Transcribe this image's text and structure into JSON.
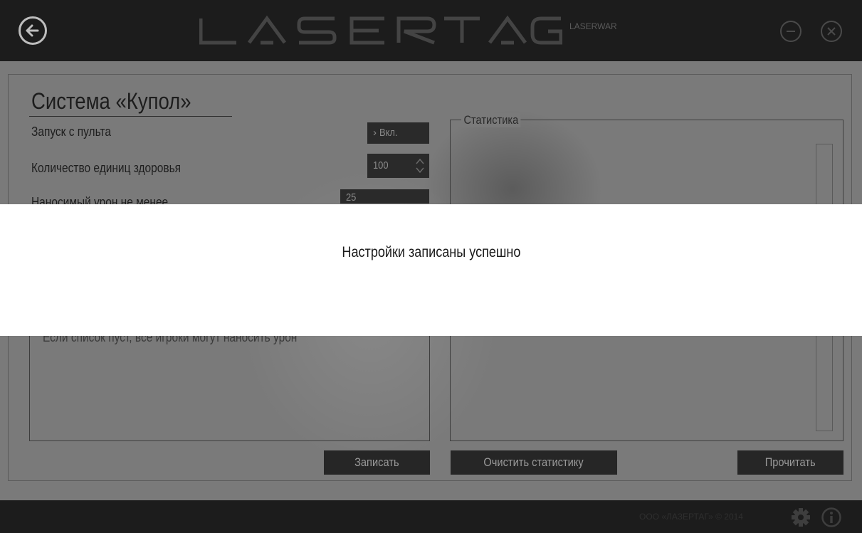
{
  "header": {
    "logo_text": "LASERTAG",
    "logo_sub": "LASERWAR"
  },
  "page": {
    "title": "Система «Купол»"
  },
  "settings": {
    "remote_start": {
      "label": "Запуск с пульта",
      "value": "Вкл."
    },
    "health_units": {
      "label": "Количество единиц здоровья",
      "value": "100"
    },
    "min_damage": {
      "label": "Наносимый урон не менее",
      "value": "25"
    },
    "empty_list_hint": "Если список пуст, все игроки могут наносить урон"
  },
  "stats": {
    "legend": "Статистика"
  },
  "buttons": {
    "write": "Записать",
    "clear_stats": "Очистить статистику",
    "read": "Прочитать"
  },
  "footer": {
    "copyright": "ООО «ЛАЗЕРТАГ» © 2014"
  },
  "notification": {
    "message": "Настройки записаны успешно"
  }
}
